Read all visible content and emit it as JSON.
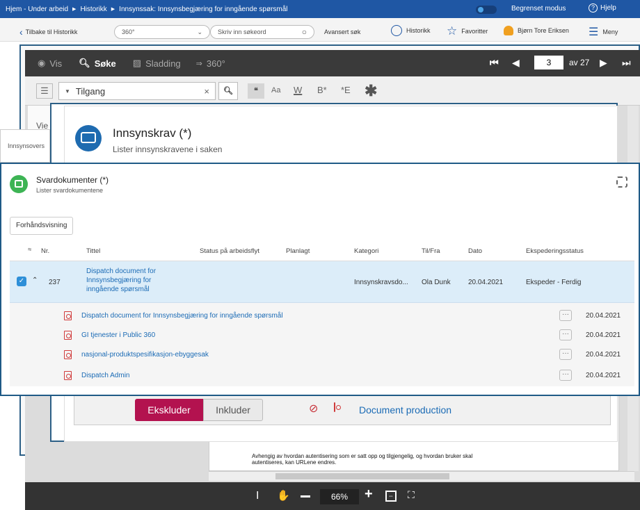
{
  "topbar": {
    "crumb1": "Hjem - Under arbeid",
    "crumb2": "Historikk",
    "crumb3": "Innsynssak: Innsynsbegjæring for inngående spørsmål",
    "mode": "Begrenset modus",
    "help": "Hjelp"
  },
  "nav": {
    "back": "Tilbake til Historikk",
    "scope": "360°",
    "search_placeholder": "Skriv inn søkeord",
    "advanced": "Avansert søk",
    "history": "Historikk",
    "favorites": "Favoritter",
    "user": "Bjørn Tore Eriksen",
    "menu": "Meny"
  },
  "viewer": {
    "tab_vis": "Vis",
    "tab_sok": "Søke",
    "tab_sladding": "Sladding",
    "tab_360": "360°",
    "page": "3",
    "page_total": "av 27",
    "filter": "Tilgang",
    "zoom": "66%",
    "doc_line1": "Avhengig av hvordan autentisering som er satt opp og tilgjengelig, og hvordan bruker skal",
    "doc_line2": "autentiseres, kan URLene endres.",
    "side_label": "Vie",
    "side_tab": "Innsynsovers"
  },
  "innsyn": {
    "title": "Innsynskrav (*)",
    "subtitle": "Lister innsynskravene i saken",
    "exclude": "Ekskluder",
    "include": "Inkluder",
    "doc": "Document production"
  },
  "svar": {
    "title": "Svardokumenter (*)",
    "subtitle": "Lister svardokumentene",
    "preview": "Forhåndsvisning",
    "headers": {
      "nr": "Nr.",
      "title": "Tittel",
      "status": "Status på arbeidsflyt",
      "planned": "Planlagt",
      "category": "Kategori",
      "tofrom": "Til/Fra",
      "date": "Dato",
      "exp": "Ekspederingsstatus"
    },
    "main_row": {
      "nr": "237",
      "title": "Dispatch document for Innsynsbegjæring for inngående spørsmål",
      "category": "Innsynskravsdo...",
      "tofrom": "Ola Dunk",
      "date": "20.04.2021",
      "exp": "Ekspeder - Ferdig"
    },
    "files": [
      {
        "name": "Dispatch document for Innsynsbegjæring for inngående spørsmål",
        "date": "20.04.2021"
      },
      {
        "name": "GI tjenester i Public 360",
        "date": "20.04.2021"
      },
      {
        "name": "nasjonal-produktspesifikasjon-ebyggesak",
        "date": "20.04.2021"
      },
      {
        "name": "Dispatch Admin",
        "date": "20.04.2021"
      }
    ]
  }
}
